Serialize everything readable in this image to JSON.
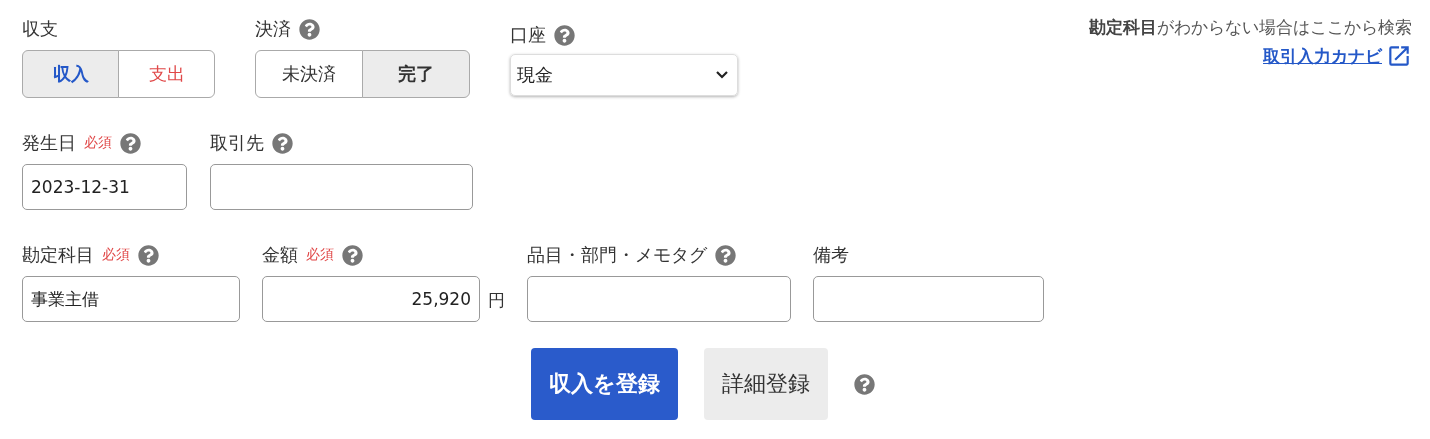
{
  "income_expense": {
    "label": "収支",
    "options": [
      {
        "label": "収入",
        "selected": true,
        "color": "#2458c8"
      },
      {
        "label": "支出",
        "selected": false,
        "color": "#e04848"
      }
    ]
  },
  "settlement": {
    "label": "決済",
    "help": true,
    "options": [
      {
        "label": "未決済",
        "selected": false
      },
      {
        "label": "完了",
        "selected": true
      }
    ]
  },
  "account": {
    "label": "口座",
    "help": true,
    "value": "現金"
  },
  "guide": {
    "text": "**勘定科目**がわからない場合はここから検索",
    "link": "取引入力カナビ"
  },
  "fields_row1": [
    {
      "label": "発生日",
      "required": "必須",
      "help": true,
      "kind": "text",
      "value": "2023-12-31"
    },
    {
      "label": "取引先",
      "help": true,
      "kind": "text"
    }
  ],
  "fields_row2": [
    {
      "label": "勘定科目",
      "required": "必須",
      "help": true,
      "kind": "text",
      "value": "事業主借"
    },
    {
      "label": "金額",
      "required": "必須",
      "help": true,
      "kind": "amount",
      "value": "25,920",
      "unit": "円"
    },
    {
      "label": "品目・部門・メモタグ",
      "help": true,
      "kind": "text"
    },
    {
      "label": "備考",
      "help": false,
      "kind": "text"
    }
  ],
  "buttons": [
    {
      "label": "収入を登録",
      "kind": "primary"
    },
    {
      "label": "詳細登録",
      "kind": "secondary"
    }
  ],
  "buttons_help": true
}
